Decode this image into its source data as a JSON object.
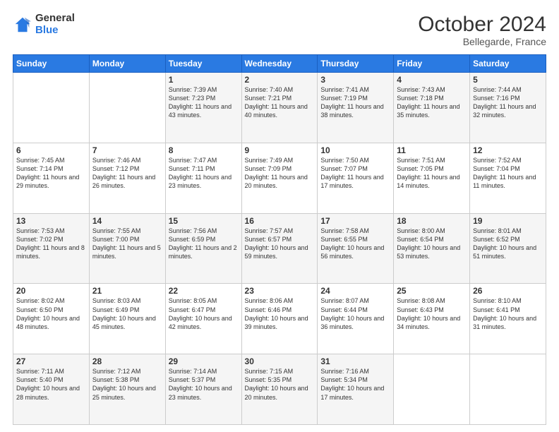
{
  "header": {
    "logo_general": "General",
    "logo_blue": "Blue",
    "title": "October 2024",
    "location": "Bellegarde, France"
  },
  "weekdays": [
    "Sunday",
    "Monday",
    "Tuesday",
    "Wednesday",
    "Thursday",
    "Friday",
    "Saturday"
  ],
  "weeks": [
    [
      {
        "day": "",
        "content": ""
      },
      {
        "day": "",
        "content": ""
      },
      {
        "day": "1",
        "content": "Sunrise: 7:39 AM\nSunset: 7:23 PM\nDaylight: 11 hours and 43 minutes."
      },
      {
        "day": "2",
        "content": "Sunrise: 7:40 AM\nSunset: 7:21 PM\nDaylight: 11 hours and 40 minutes."
      },
      {
        "day": "3",
        "content": "Sunrise: 7:41 AM\nSunset: 7:19 PM\nDaylight: 11 hours and 38 minutes."
      },
      {
        "day": "4",
        "content": "Sunrise: 7:43 AM\nSunset: 7:18 PM\nDaylight: 11 hours and 35 minutes."
      },
      {
        "day": "5",
        "content": "Sunrise: 7:44 AM\nSunset: 7:16 PM\nDaylight: 11 hours and 32 minutes."
      }
    ],
    [
      {
        "day": "6",
        "content": "Sunrise: 7:45 AM\nSunset: 7:14 PM\nDaylight: 11 hours and 29 minutes."
      },
      {
        "day": "7",
        "content": "Sunrise: 7:46 AM\nSunset: 7:12 PM\nDaylight: 11 hours and 26 minutes."
      },
      {
        "day": "8",
        "content": "Sunrise: 7:47 AM\nSunset: 7:11 PM\nDaylight: 11 hours and 23 minutes."
      },
      {
        "day": "9",
        "content": "Sunrise: 7:49 AM\nSunset: 7:09 PM\nDaylight: 11 hours and 20 minutes."
      },
      {
        "day": "10",
        "content": "Sunrise: 7:50 AM\nSunset: 7:07 PM\nDaylight: 11 hours and 17 minutes."
      },
      {
        "day": "11",
        "content": "Sunrise: 7:51 AM\nSunset: 7:05 PM\nDaylight: 11 hours and 14 minutes."
      },
      {
        "day": "12",
        "content": "Sunrise: 7:52 AM\nSunset: 7:04 PM\nDaylight: 11 hours and 11 minutes."
      }
    ],
    [
      {
        "day": "13",
        "content": "Sunrise: 7:53 AM\nSunset: 7:02 PM\nDaylight: 11 hours and 8 minutes."
      },
      {
        "day": "14",
        "content": "Sunrise: 7:55 AM\nSunset: 7:00 PM\nDaylight: 11 hours and 5 minutes."
      },
      {
        "day": "15",
        "content": "Sunrise: 7:56 AM\nSunset: 6:59 PM\nDaylight: 11 hours and 2 minutes."
      },
      {
        "day": "16",
        "content": "Sunrise: 7:57 AM\nSunset: 6:57 PM\nDaylight: 10 hours and 59 minutes."
      },
      {
        "day": "17",
        "content": "Sunrise: 7:58 AM\nSunset: 6:55 PM\nDaylight: 10 hours and 56 minutes."
      },
      {
        "day": "18",
        "content": "Sunrise: 8:00 AM\nSunset: 6:54 PM\nDaylight: 10 hours and 53 minutes."
      },
      {
        "day": "19",
        "content": "Sunrise: 8:01 AM\nSunset: 6:52 PM\nDaylight: 10 hours and 51 minutes."
      }
    ],
    [
      {
        "day": "20",
        "content": "Sunrise: 8:02 AM\nSunset: 6:50 PM\nDaylight: 10 hours and 48 minutes."
      },
      {
        "day": "21",
        "content": "Sunrise: 8:03 AM\nSunset: 6:49 PM\nDaylight: 10 hours and 45 minutes."
      },
      {
        "day": "22",
        "content": "Sunrise: 8:05 AM\nSunset: 6:47 PM\nDaylight: 10 hours and 42 minutes."
      },
      {
        "day": "23",
        "content": "Sunrise: 8:06 AM\nSunset: 6:46 PM\nDaylight: 10 hours and 39 minutes."
      },
      {
        "day": "24",
        "content": "Sunrise: 8:07 AM\nSunset: 6:44 PM\nDaylight: 10 hours and 36 minutes."
      },
      {
        "day": "25",
        "content": "Sunrise: 8:08 AM\nSunset: 6:43 PM\nDaylight: 10 hours and 34 minutes."
      },
      {
        "day": "26",
        "content": "Sunrise: 8:10 AM\nSunset: 6:41 PM\nDaylight: 10 hours and 31 minutes."
      }
    ],
    [
      {
        "day": "27",
        "content": "Sunrise: 7:11 AM\nSunset: 5:40 PM\nDaylight: 10 hours and 28 minutes."
      },
      {
        "day": "28",
        "content": "Sunrise: 7:12 AM\nSunset: 5:38 PM\nDaylight: 10 hours and 25 minutes."
      },
      {
        "day": "29",
        "content": "Sunrise: 7:14 AM\nSunset: 5:37 PM\nDaylight: 10 hours and 23 minutes."
      },
      {
        "day": "30",
        "content": "Sunrise: 7:15 AM\nSunset: 5:35 PM\nDaylight: 10 hours and 20 minutes."
      },
      {
        "day": "31",
        "content": "Sunrise: 7:16 AM\nSunset: 5:34 PM\nDaylight: 10 hours and 17 minutes."
      },
      {
        "day": "",
        "content": ""
      },
      {
        "day": "",
        "content": ""
      }
    ]
  ]
}
